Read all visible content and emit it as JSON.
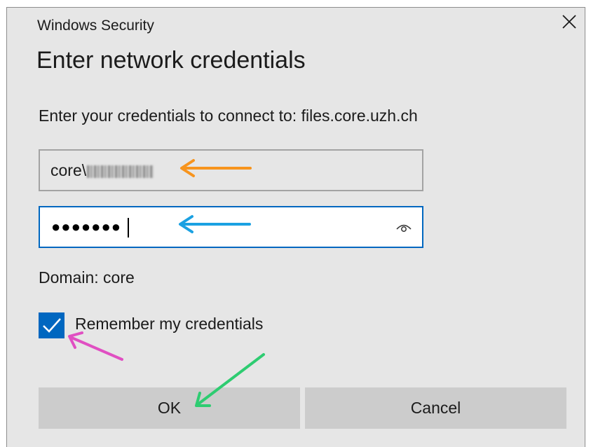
{
  "window": {
    "title": "Windows Security",
    "close_icon": "close-icon"
  },
  "dialog": {
    "heading": "Enter network credentials",
    "prompt": "Enter your credentials to connect to: files.core.uzh.ch"
  },
  "username_field": {
    "visible_prefix": "core\\",
    "masked_suffix": "blurred-username"
  },
  "password_field": {
    "value": "●●●●●●●",
    "reveal_icon": "eye-icon"
  },
  "domain_text": "Domain: core",
  "remember": {
    "label": "Remember my credentials",
    "checked": true
  },
  "buttons": {
    "ok": "OK",
    "cancel": "Cancel"
  },
  "annotation_colors": {
    "username_arrow": "#f7941d",
    "password_arrow": "#1ba1e2",
    "checkbox_arrow": "#e04fc2",
    "ok_arrow": "#2ecc71"
  },
  "theme": {
    "accent": "#0067c0",
    "dialog_bg": "#e6e6e6",
    "button_bg": "#cccccc"
  }
}
